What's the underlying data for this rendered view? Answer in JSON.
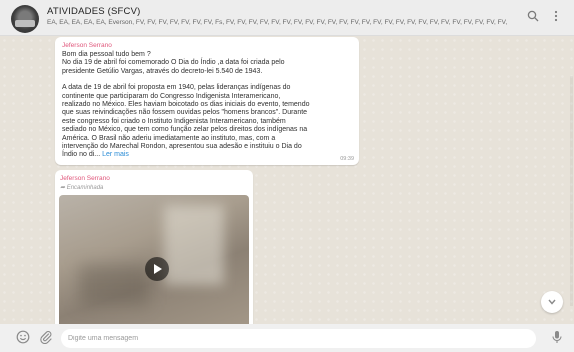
{
  "header": {
    "group_name": "ATIVIDADES (SFCV)",
    "members": "EA, EA, EA, EA, EA, Everson, FV, FV, FV, FV, FV, FV, FV, Fs, FV, FV, FV, FV, FV, FV, FV, FV, FV, FV, FV, FV, FV, FV, FV, FV, FV, FV, FV, FV, FV, FV, FV, FV, FV, ..."
  },
  "messages": [
    {
      "sender": "Jeferson Serrano",
      "paragraphs": [
        [
          "Bom dia pessoal tudo bem ?",
          "No dia  19 de abril foi comemorado O Dia do Índio ,a data foi criada pelo",
          "presidente Getúlio Vargas, através do decreto-lei 5.540 de 1943."
        ],
        [
          "A data de 19 de abril foi proposta em 1940, pelas lideranças indígenas do",
          "continente que participaram do Congresso Indigenista Interamericano,",
          "realizado no México. Eles haviam boicotado os dias iniciais do evento, temendo",
          "que suas reivindicações não fossem ouvidas pelos \"homens brancos\". Durante",
          "este congresso foi criado o Instituto Indigenista Interamericano, também",
          "sediado no México, que tem como função zelar pelos direitos dos indígenas na",
          "América. O Brasil não aderiu imediatamente ao instituto, mas, com a",
          "intervenção do Marechal Rondon, apresentou sua adesão e instituiu o Dia do"
        ]
      ],
      "last_line": "Índio no di...",
      "read_more": "Ler mais",
      "time": "09:39"
    },
    {
      "sender": "Jeferson Serrano",
      "forwarded_label": "Encaminhada"
    }
  ],
  "composer": {
    "placeholder": "Digite uma mensagem"
  },
  "icons": {
    "search": "search-icon",
    "menu": "more-vertical-icon",
    "emoji": "emoji-icon",
    "attach": "attach-icon",
    "mic": "mic-icon",
    "scroll_down": "chevron-down-icon",
    "play": "play-icon",
    "forward": "forward-arrow-icon"
  }
}
